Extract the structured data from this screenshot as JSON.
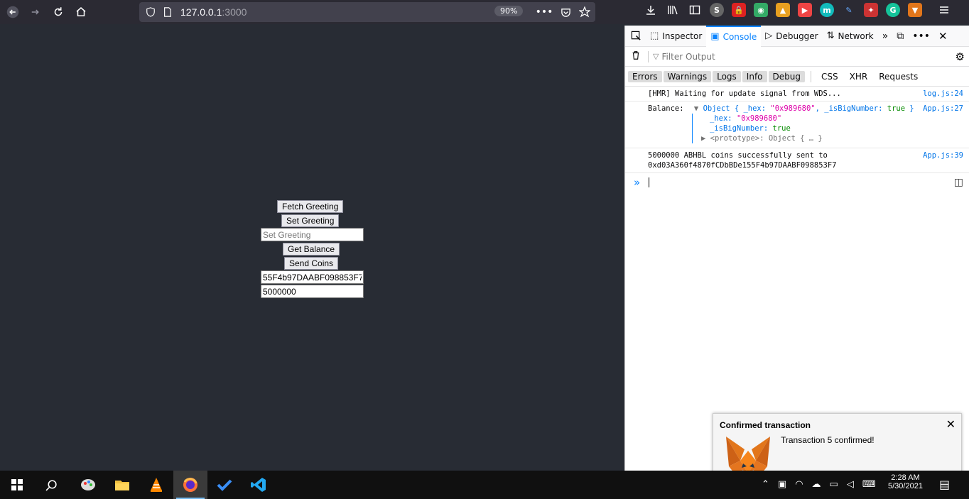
{
  "browser": {
    "url_host": "127.0.0.1",
    "url_port": ":3000",
    "zoom": "90%"
  },
  "app": {
    "fetch_greeting_label": "Fetch Greeting",
    "set_greeting_label": "Set Greeting",
    "greeting_placeholder": "Set Greeting",
    "get_balance_label": "Get Balance",
    "send_coins_label": "Send Coins",
    "address_value": "55F4b97DAABF098853F7",
    "amount_value": "5000000"
  },
  "devtools": {
    "tabs": [
      "Inspector",
      "Console",
      "Debugger",
      "Network"
    ],
    "filter_placeholder": "Filter Output",
    "levels": [
      "Errors",
      "Warnings",
      "Logs",
      "Info",
      "Debug"
    ],
    "extra_filters": [
      "CSS",
      "XHR",
      "Requests"
    ],
    "logs": [
      {
        "text": "[HMR] Waiting for update signal from WDS...",
        "source": "log.js:24"
      },
      {
        "label": "Balance:",
        "object_summary_pre": "Object { _hex: ",
        "hex_value": "\"0x989680\"",
        "object_summary_mid": ", _isBigNumber: ",
        "bool_value": "true",
        "object_summary_post": " }",
        "hex_key": "_hex:",
        "bignum_key": "_isBigNumber:",
        "proto_text": "<prototype>: Object { … }",
        "source": "App.js:27"
      },
      {
        "line1": "5000000 ABHBL coins successfully sent to",
        "line2": "0xd03A360f4870fCDbBDe155F4b97DAABF098853F7",
        "source": "App.js:39"
      }
    ]
  },
  "notification": {
    "title": "Confirmed transaction",
    "message": "Transaction 5 confirmed!"
  },
  "taskbar": {
    "time": "2:28 AM",
    "date": "5/30/2021"
  }
}
